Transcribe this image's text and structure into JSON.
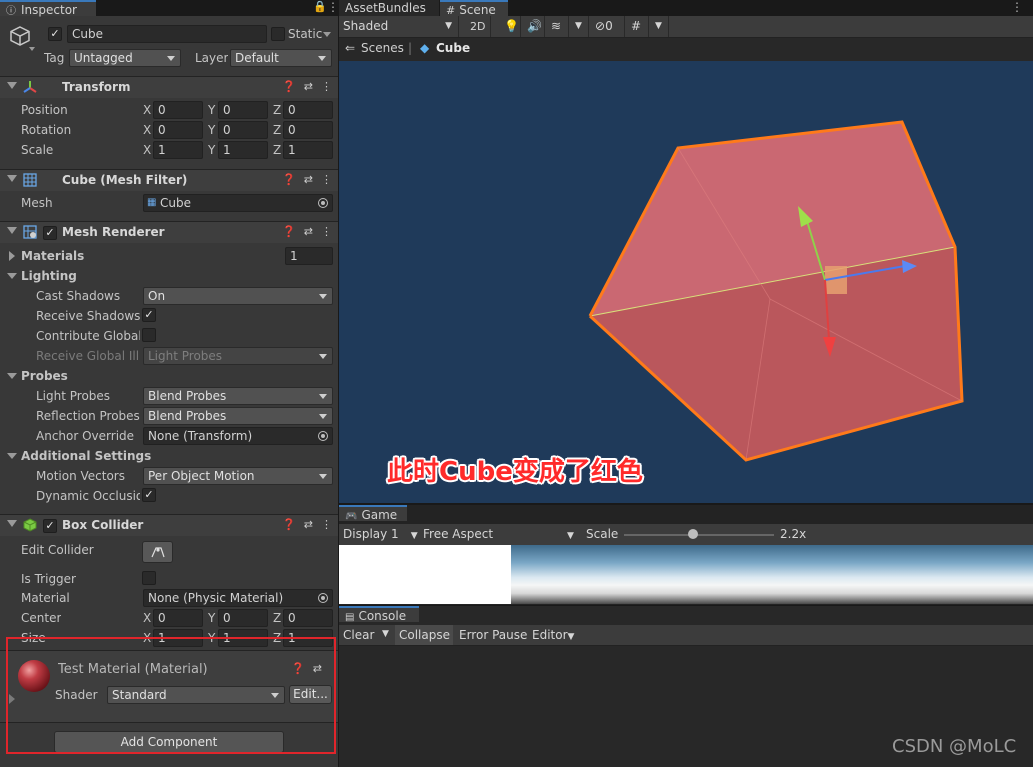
{
  "inspector": {
    "tab": "Inspector",
    "object": {
      "name": "Cube",
      "static_label": "Static",
      "tag_label": "Tag",
      "tag": "Untagged",
      "layer_label": "Layer",
      "layer": "Default"
    },
    "transform": {
      "title": "Transform",
      "position": {
        "label": "Position",
        "x": "0",
        "y": "0",
        "z": "0"
      },
      "rotation": {
        "label": "Rotation",
        "x": "0",
        "y": "0",
        "z": "0"
      },
      "scale": {
        "label": "Scale",
        "x": "1",
        "y": "1",
        "z": "1"
      }
    },
    "mesh_filter": {
      "title": "Cube (Mesh Filter)",
      "mesh_label": "Mesh",
      "mesh": "Cube"
    },
    "mesh_renderer": {
      "title": "Mesh Renderer",
      "materials_label": "Materials",
      "materials_count": "1",
      "lighting_label": "Lighting",
      "cast_shadows_label": "Cast Shadows",
      "cast_shadows": "On",
      "receive_shadows_label": "Receive Shadows",
      "contribute_gi_label": "Contribute Global I",
      "receive_gi_label": "Receive Global Illu",
      "receive_gi": "Light Probes",
      "probes_label": "Probes",
      "light_probes_label": "Light Probes",
      "light_probes": "Blend Probes",
      "reflection_probes_label": "Reflection Probes",
      "reflection_probes": "Blend Probes",
      "anchor_override_label": "Anchor Override",
      "anchor_override": "None (Transform)",
      "additional_label": "Additional Settings",
      "motion_vectors_label": "Motion Vectors",
      "motion_vectors": "Per Object Motion",
      "dynamic_occlusion_label": "Dynamic Occlusion"
    },
    "box_collider": {
      "title": "Box Collider",
      "edit_collider_label": "Edit Collider",
      "is_trigger_label": "Is Trigger",
      "material_label": "Material",
      "material": "None (Physic Material)",
      "center": {
        "label": "Center",
        "x": "0",
        "y": "0",
        "z": "0"
      },
      "size": {
        "label": "Size",
        "x": "1",
        "y": "1",
        "z": "1"
      }
    },
    "material": {
      "title": "Test Material (Material)",
      "shader_label": "Shader",
      "shader": "Standard",
      "edit_label": "Edit..."
    },
    "add_component": "Add Component",
    "axis_x": "X",
    "axis_y": "Y",
    "axis_z": "Z",
    "checkmark": "✓"
  },
  "tabs": {
    "asset_bundles": "AssetBundles",
    "scene": "Scene",
    "game": "Game",
    "console": "Console"
  },
  "scene": {
    "toolbar": {
      "shading": "Shaded",
      "mode_2d": "2D",
      "hidden_count": "0"
    },
    "breadcrumb": {
      "root": "Scenes",
      "current": "Cube"
    },
    "annotation": "此时Cube变成了红色",
    "colors": {
      "background": "#1f3a5a",
      "cube_fill": "#c85a5c",
      "outline": "#ff7a1a"
    }
  },
  "game": {
    "display": "Display 1",
    "aspect": "Free Aspect",
    "scale_label": "Scale",
    "scale_value": "2.2x",
    "scale_slider_fraction": 0.46
  },
  "console": {
    "clear": "Clear",
    "collapse": "Collapse",
    "error_pause": "Error Pause",
    "editor": "Editor"
  },
  "watermark": "CSDN @MoLC",
  "highlight_color": "#e0252b"
}
